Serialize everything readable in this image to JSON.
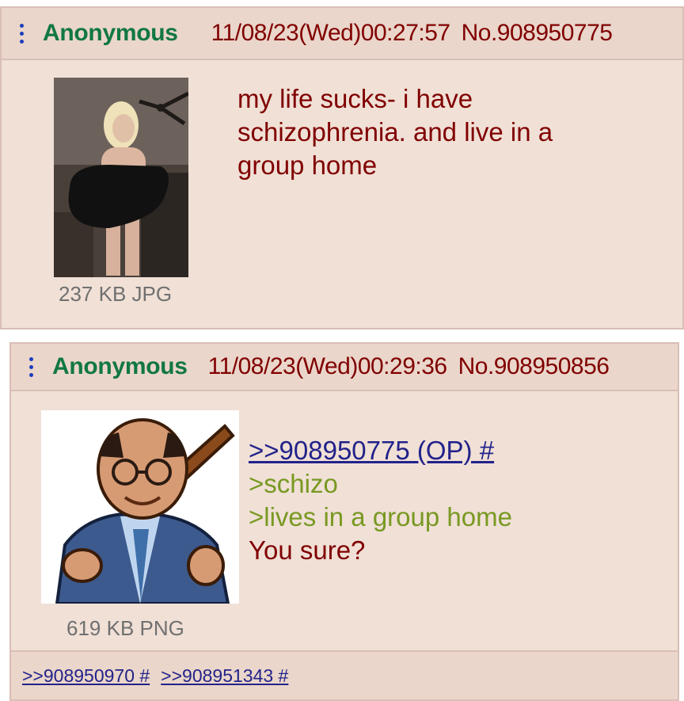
{
  "posts": [
    {
      "name": "Anonymous",
      "datetime": "11/08/23(Wed)00:27:57",
      "post_no": "No.908950775",
      "file_info": "237 KB JPG",
      "comment_lines": [
        "my life sucks- i have",
        "schizophrenia. and live in a",
        "group home"
      ]
    },
    {
      "name": "Anonymous",
      "datetime": "11/08/23(Wed)00:29:36",
      "post_no": "No.908950856",
      "file_info": "619 KB PNG",
      "quote_link": ">>908950775 (OP) #",
      "greentext": [
        ">schizo",
        ">lives in a group home"
      ],
      "comment_line": "You sure?",
      "backlinks": [
        ">>908950970 #",
        ">>908951343 #"
      ]
    }
  ],
  "colors": {
    "post_bg": "#f0e0d6",
    "header_bg": "#ead6ca",
    "name": "#117743",
    "text": "#800000",
    "link": "#22228a",
    "greentext": "#789922",
    "fileinfo": "#707070"
  },
  "icons": [
    "more-options-icon",
    "image-thumbnail"
  ]
}
